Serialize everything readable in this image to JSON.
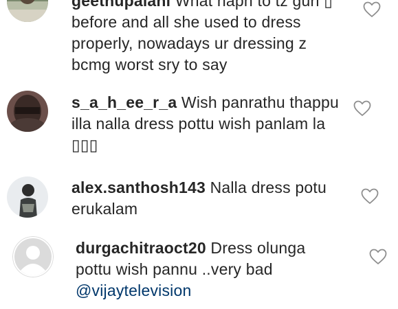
{
  "comments": [
    {
      "username": "geethupalani",
      "text": "What hapn to tz gurl ▯ before and all she used to dress properly, nowadays ur dressing z bcmg worst sry to say",
      "mention": "",
      "avatar_icon": "profile-photo-icon",
      "like_icon": "heart-outline-icon"
    },
    {
      "username": "s_a_h_ee_r_a",
      "text": "Wish panrathu thappu illa nalla dress pottu wish panlam la ▯▯▯",
      "mention": "",
      "avatar_icon": "profile-photo-icon",
      "like_icon": "heart-outline-icon"
    },
    {
      "username": "alex.santhosh143",
      "text": "Nalla dress potu erukalam",
      "mention": "",
      "avatar_icon": "profile-photo-icon",
      "like_icon": "heart-outline-icon"
    },
    {
      "username": "durgachitraoct20",
      "text": "Dress olunga pottu wish pannu ..very bad",
      "mention": "@vijaytelevision",
      "avatar_icon": "default-avatar-icon",
      "like_icon": "heart-outline-icon"
    }
  ],
  "colors": {
    "text": "#262626",
    "mention": "#00376b",
    "icon": "#8e8e8e",
    "default_avatar_bg": "#dbdbdb"
  }
}
